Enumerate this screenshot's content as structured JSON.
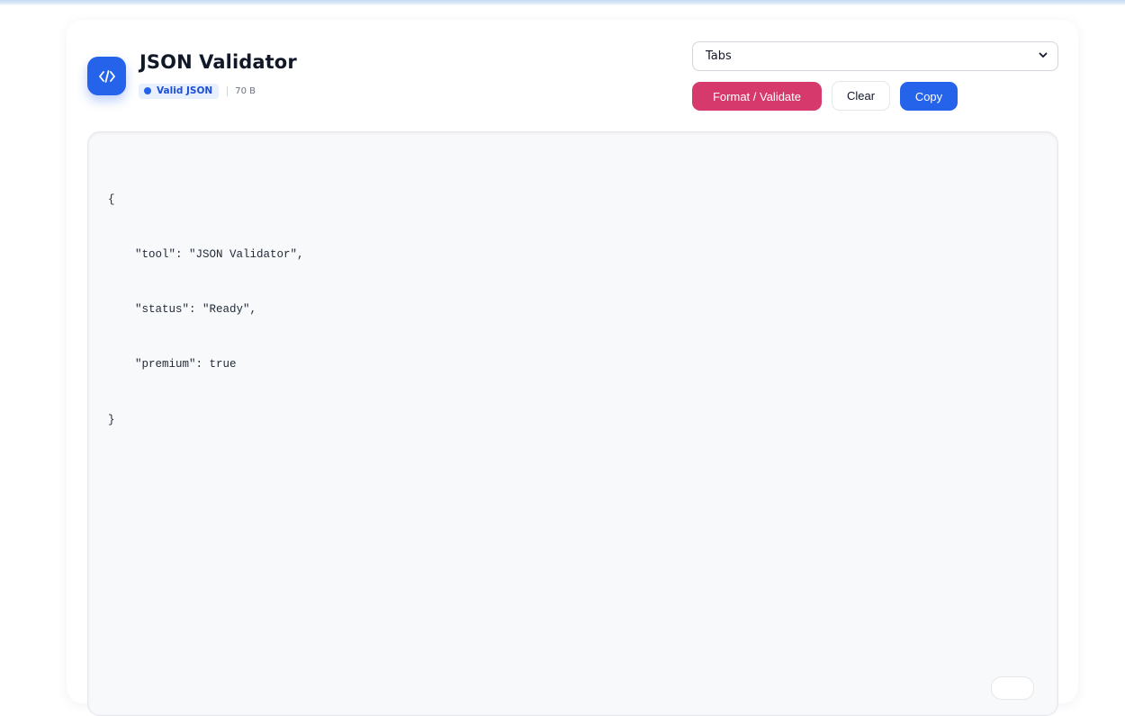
{
  "header": {
    "title": "JSON Validator",
    "status_badge": "Valid JSON",
    "size": "70 B"
  },
  "controls": {
    "indent_select": "Tabs",
    "format_label": "Format / Validate",
    "clear_label": "Clear",
    "copy_label": "Copy"
  },
  "editor": {
    "lines": [
      "{",
      "    \"tool\": \"JSON Validator\",",
      "    \"status\": \"Ready\",",
      "    \"premium\": true",
      "}"
    ]
  },
  "colors": {
    "accent": "#2563eb",
    "format_button": "#d63a6d",
    "badge_bg": "#e8f0fd"
  },
  "icons": {
    "logo": "code-icon",
    "select_arrow": "chevron-down-icon"
  }
}
